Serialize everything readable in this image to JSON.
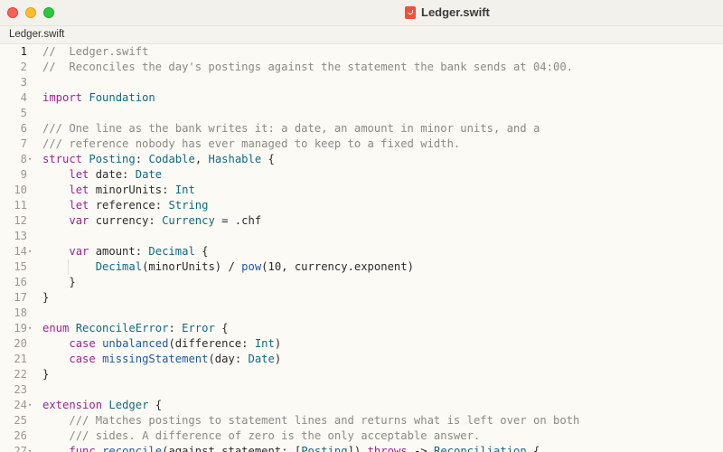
{
  "window": {
    "title": "Ledger.swift",
    "file_icon": "swift-file-icon",
    "colors": {
      "close": "#ff5f57",
      "minimize": "#febc2e",
      "zoom": "#28c840"
    }
  },
  "tab": {
    "label": "Ledger.swift"
  },
  "editor": {
    "current_line": 1,
    "colors": {
      "comment": "#8a8a85",
      "keyword": "#9b2393",
      "type": "#0f6a80",
      "function": "#1e5a9e",
      "plain": "#2b2b2b"
    },
    "lines": [
      {
        "n": "1",
        "tokens": [
          [
            "cm",
            "//  Ledger.swift"
          ]
        ]
      },
      {
        "n": "2",
        "tokens": [
          [
            "cm",
            "//  Reconciles the day's postings against the statement the bank sends at 04:00."
          ]
        ]
      },
      {
        "n": "3",
        "tokens": []
      },
      {
        "n": "4",
        "tokens": [
          [
            "kw",
            "import"
          ],
          [
            "pl",
            " "
          ],
          [
            "ty",
            "Foundation"
          ]
        ]
      },
      {
        "n": "5",
        "tokens": []
      },
      {
        "n": "6",
        "tokens": [
          [
            "cm",
            "/// One line as the bank writes it: a date, an amount in minor units, and a"
          ]
        ]
      },
      {
        "n": "7",
        "tokens": [
          [
            "cm",
            "/// reference nobody has ever managed to keep to a fixed width."
          ]
        ]
      },
      {
        "n": "8",
        "fold": true,
        "tokens": [
          [
            "kw",
            "struct"
          ],
          [
            "pl",
            " "
          ],
          [
            "ty",
            "Posting"
          ],
          [
            "pl",
            ": "
          ],
          [
            "ty",
            "Codable"
          ],
          [
            "pl",
            ", "
          ],
          [
            "ty",
            "Hashable"
          ],
          [
            "pl",
            " {"
          ]
        ]
      },
      {
        "n": "9",
        "guides": 0,
        "tokens": [
          [
            "pl",
            "    "
          ],
          [
            "kw",
            "let"
          ],
          [
            "pl",
            " date: "
          ],
          [
            "ty",
            "Date"
          ]
        ]
      },
      {
        "n": "10",
        "guides": 0,
        "tokens": [
          [
            "pl",
            "    "
          ],
          [
            "kw",
            "let"
          ],
          [
            "pl",
            " minorUnits: "
          ],
          [
            "ty",
            "Int"
          ]
        ]
      },
      {
        "n": "11",
        "guides": 0,
        "tokens": [
          [
            "pl",
            "    "
          ],
          [
            "kw",
            "let"
          ],
          [
            "pl",
            " reference: "
          ],
          [
            "ty",
            "String"
          ]
        ]
      },
      {
        "n": "12",
        "guides": 0,
        "tokens": [
          [
            "pl",
            "    "
          ],
          [
            "kw",
            "var"
          ],
          [
            "pl",
            " currency: "
          ],
          [
            "ty",
            "Currency"
          ],
          [
            "pl",
            " = .chf"
          ]
        ]
      },
      {
        "n": "13",
        "tokens": []
      },
      {
        "n": "14",
        "fold": true,
        "tokens": [
          [
            "pl",
            "    "
          ],
          [
            "kw",
            "var"
          ],
          [
            "pl",
            " amount: "
          ],
          [
            "ty",
            "Decimal"
          ],
          [
            "pl",
            " {"
          ]
        ]
      },
      {
        "n": "15",
        "guides": 1,
        "tokens": [
          [
            "pl",
            "        "
          ],
          [
            "ty",
            "Decimal"
          ],
          [
            "pl",
            "(minorUnits) / "
          ],
          [
            "fn",
            "pow"
          ],
          [
            "pl",
            "(10, currency.exponent)"
          ]
        ]
      },
      {
        "n": "16",
        "tokens": [
          [
            "pl",
            "    }"
          ]
        ]
      },
      {
        "n": "17",
        "tokens": [
          [
            "pl",
            "}"
          ]
        ]
      },
      {
        "n": "18",
        "tokens": []
      },
      {
        "n": "19",
        "fold": true,
        "tokens": [
          [
            "kw",
            "enum"
          ],
          [
            "pl",
            " "
          ],
          [
            "ty",
            "ReconcileError"
          ],
          [
            "pl",
            ": "
          ],
          [
            "ty",
            "Error"
          ],
          [
            "pl",
            " {"
          ]
        ]
      },
      {
        "n": "20",
        "tokens": [
          [
            "pl",
            "    "
          ],
          [
            "kw",
            "case"
          ],
          [
            "pl",
            " "
          ],
          [
            "fn",
            "unbalanced"
          ],
          [
            "pl",
            "(difference: "
          ],
          [
            "ty",
            "Int"
          ],
          [
            "pl",
            ")"
          ]
        ]
      },
      {
        "n": "21",
        "tokens": [
          [
            "pl",
            "    "
          ],
          [
            "kw",
            "case"
          ],
          [
            "pl",
            " "
          ],
          [
            "fn",
            "missingStatement"
          ],
          [
            "pl",
            "(day: "
          ],
          [
            "ty",
            "Date"
          ],
          [
            "pl",
            ")"
          ]
        ]
      },
      {
        "n": "22",
        "tokens": [
          [
            "pl",
            "}"
          ]
        ]
      },
      {
        "n": "23",
        "tokens": []
      },
      {
        "n": "24",
        "fold": true,
        "tokens": [
          [
            "kw",
            "extension"
          ],
          [
            "pl",
            " "
          ],
          [
            "ty",
            "Ledger"
          ],
          [
            "pl",
            " {"
          ]
        ]
      },
      {
        "n": "25",
        "tokens": [
          [
            "pl",
            "    "
          ],
          [
            "cm",
            "/// Matches postings to statement lines and returns what is left over on both"
          ]
        ]
      },
      {
        "n": "26",
        "tokens": [
          [
            "pl",
            "    "
          ],
          [
            "cm",
            "/// sides. A difference of zero is the only acceptable answer."
          ]
        ]
      },
      {
        "n": "27",
        "fold": true,
        "tokens": [
          [
            "pl",
            "    "
          ],
          [
            "kw",
            "func"
          ],
          [
            "pl",
            " "
          ],
          [
            "fn",
            "reconcile"
          ],
          [
            "pl",
            "(against statement: ["
          ],
          [
            "ty",
            "Posting"
          ],
          [
            "pl",
            "]) "
          ],
          [
            "kw",
            "throws"
          ],
          [
            "pl",
            " -> "
          ],
          [
            "ty",
            "Reconciliation"
          ],
          [
            "pl",
            " {"
          ]
        ]
      }
    ]
  }
}
